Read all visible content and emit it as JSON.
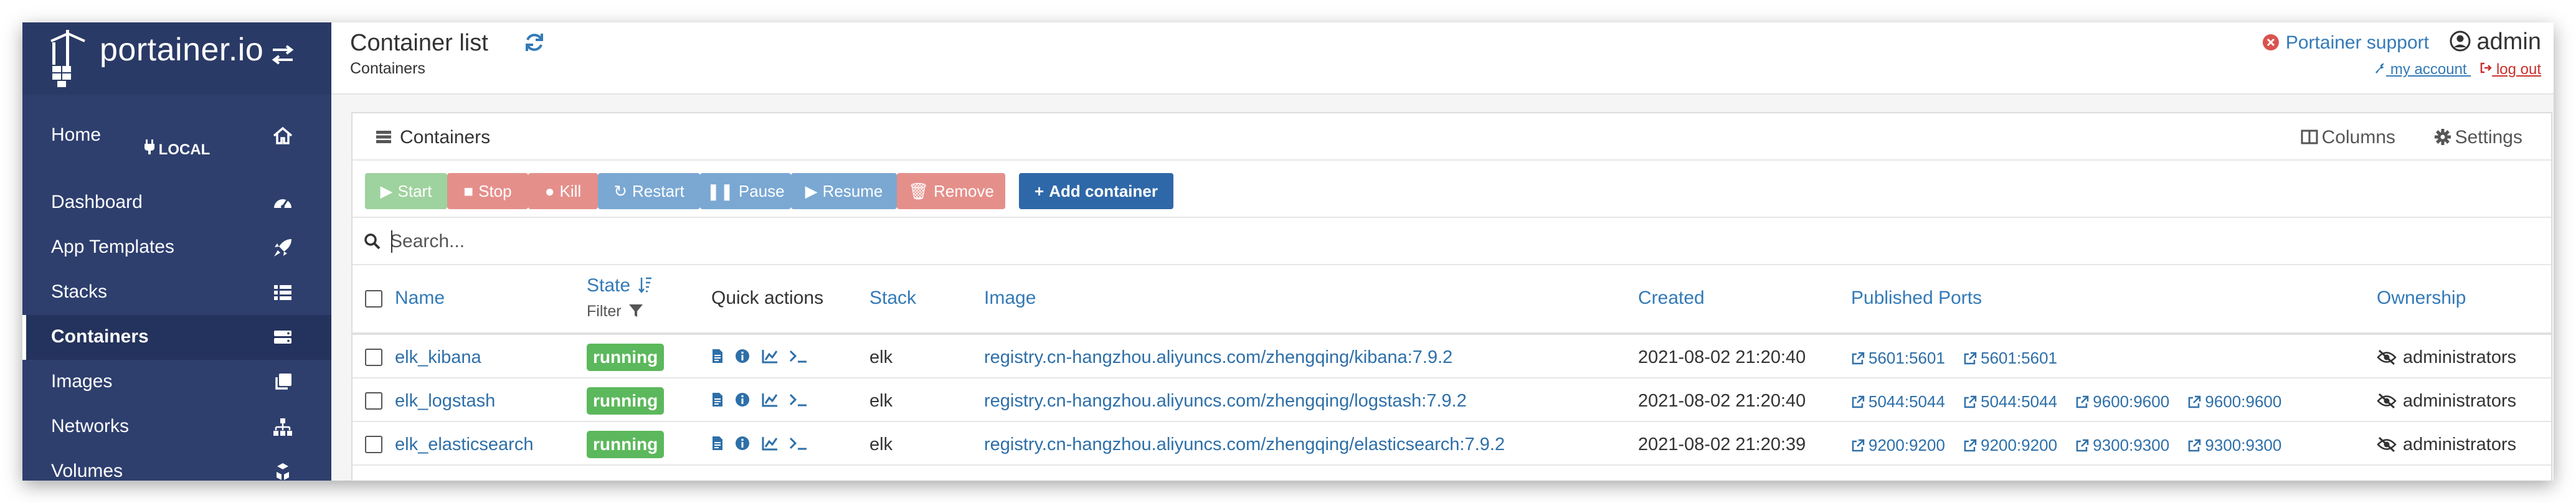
{
  "sidebar": {
    "brand": "portainer.io",
    "endpoint": "LOCAL",
    "items": [
      {
        "label": "Home",
        "icon": "home-icon"
      },
      {
        "label": "Dashboard",
        "icon": "dashboard-icon"
      },
      {
        "label": "App Templates",
        "icon": "rocket-icon"
      },
      {
        "label": "Stacks",
        "icon": "list-icon"
      },
      {
        "label": "Containers",
        "icon": "server-icon",
        "active": true
      },
      {
        "label": "Images",
        "icon": "clone-icon"
      },
      {
        "label": "Networks",
        "icon": "sitemap-icon"
      },
      {
        "label": "Volumes",
        "icon": "cubes-icon"
      }
    ]
  },
  "header": {
    "title": "Container list",
    "breadcrumb": "Containers",
    "support": "Portainer support",
    "user": "admin",
    "my_account": "my account",
    "log_out": "log out"
  },
  "panel": {
    "title": "Containers",
    "columns": "Columns",
    "settings": "Settings",
    "actions": {
      "start": "Start",
      "stop": "Stop",
      "kill": "Kill",
      "restart": "Restart",
      "pause": "Pause",
      "resume": "Resume",
      "remove": "Remove",
      "add": "Add container"
    },
    "search_placeholder": "Search..."
  },
  "table": {
    "headers": {
      "name": "Name",
      "state": "State",
      "state_filter": "Filter",
      "quick_actions": "Quick actions",
      "stack": "Stack",
      "image": "Image",
      "created": "Created",
      "ports": "Published Ports",
      "ownership": "Ownership"
    },
    "rows": [
      {
        "name": "elk_kibana",
        "state": "running",
        "stack": "elk",
        "image": "registry.cn-hangzhou.aliyuncs.com/zhengqing/kibana:7.9.2",
        "created": "2021-08-02 21:20:40",
        "ports": [
          "5601:5601",
          "5601:5601"
        ],
        "ownership": "administrators"
      },
      {
        "name": "elk_logstash",
        "state": "running",
        "stack": "elk",
        "image": "registry.cn-hangzhou.aliyuncs.com/zhengqing/logstash:7.9.2",
        "created": "2021-08-02 21:20:40",
        "ports": [
          "5044:5044",
          "5044:5044",
          "9600:9600",
          "9600:9600"
        ],
        "ownership": "administrators"
      },
      {
        "name": "elk_elasticsearch",
        "state": "running",
        "stack": "elk",
        "image": "registry.cn-hangzhou.aliyuncs.com/zhengqing/elasticsearch:7.9.2",
        "created": "2021-08-02 21:20:39",
        "ports": [
          "9200:9200",
          "9200:9200",
          "9300:9300",
          "9300:9300"
        ],
        "ownership": "administrators"
      }
    ]
  },
  "colors": {
    "sidebar": "#2e3f6e",
    "link": "#337ab7",
    "running": "#5cb85c",
    "primary": "#2f68a8"
  }
}
